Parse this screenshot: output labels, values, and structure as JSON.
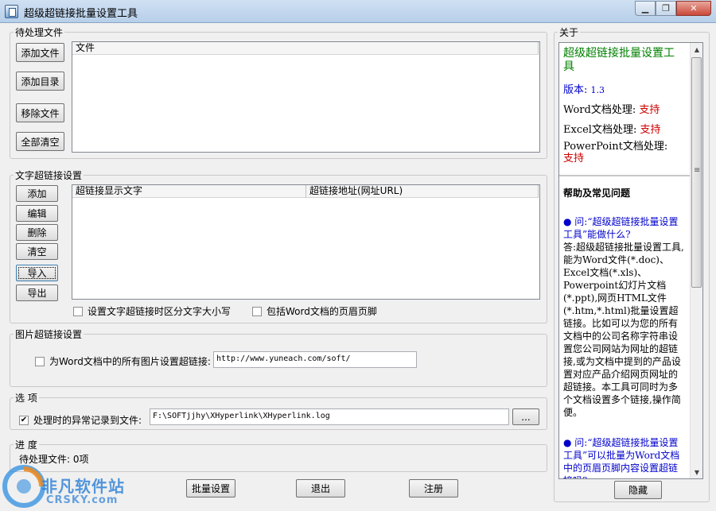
{
  "window": {
    "title": "超级超链接批量设置工具",
    "controls": [
      "▁",
      "❐",
      "✕"
    ]
  },
  "files": {
    "legend": "待处理文件",
    "buttons": [
      "添加文件",
      "添加目录",
      "移除文件",
      "全部清空"
    ],
    "column": "文件"
  },
  "links": {
    "legend": "文字超链接设置",
    "buttons": [
      "添加",
      "编辑",
      "删除",
      "清空",
      "导入",
      "导出"
    ],
    "columns": [
      "超链接显示文字",
      "超链接地址(网址URL)"
    ],
    "case_check": "设置文字超链接时区分文字大小写",
    "header_check": "包括Word文档的页眉页脚"
  },
  "image": {
    "legend": "图片超链接设置",
    "check": "为Word文档中的所有图片设置超链接:",
    "url": "http://www.yuneach.com/soft/"
  },
  "options": {
    "legend": "选  项",
    "check": "处理时的异常记录到文件:",
    "path": "F:\\SOFTjjhy\\XHyperlink\\XHyperlink.log",
    "browse": "..."
  },
  "progress": {
    "legend": "进  度",
    "status": "待处理文件: 0项"
  },
  "bottom": {
    "batch": "批量设置",
    "exit": "退出",
    "register": "注册",
    "hide": "隐藏"
  },
  "about": {
    "legend": "关于",
    "app_name": "超级超链接批量设置工具",
    "version_label": "版本:",
    "version": "1.3",
    "word_label": "Word文档处理:",
    "word_val": "支持",
    "excel_label": "Excel文档处理:",
    "excel_val": "支持",
    "ppt_label": "PowerPoint文档处理:",
    "ppt_val": "支持",
    "faq_title": "帮助及常见问题",
    "q1": "● 问:“超级超链接批量设置工具”能做什么?",
    "a1": "答:超级超链接批量设置工具,能为Word文件(*.doc)、Excel文档(*.xls)、Powerpoint幻灯片文档(*.ppt),网页HTML文件(*.htm,*.html)批量设置超链接。比如可以为您的所有文档中的公司名称字符串设置您公司网站为网址的超链接,或为文档中提到的产品设置对应产品介绍网页网址的超链接。本工具可同时为多个文档设置多个链接,操作简便。",
    "q2": "● 问:“超级超链接批量设置工具”可以批量为Word文档中的页眉页脚内容设置超链接吗?"
  },
  "watermark": {
    "brand": "非凡软件站",
    "domain": "CRSKY.com"
  },
  "colors": {
    "green": "#008000",
    "blue": "#0000cc",
    "red": "#cc0000"
  }
}
